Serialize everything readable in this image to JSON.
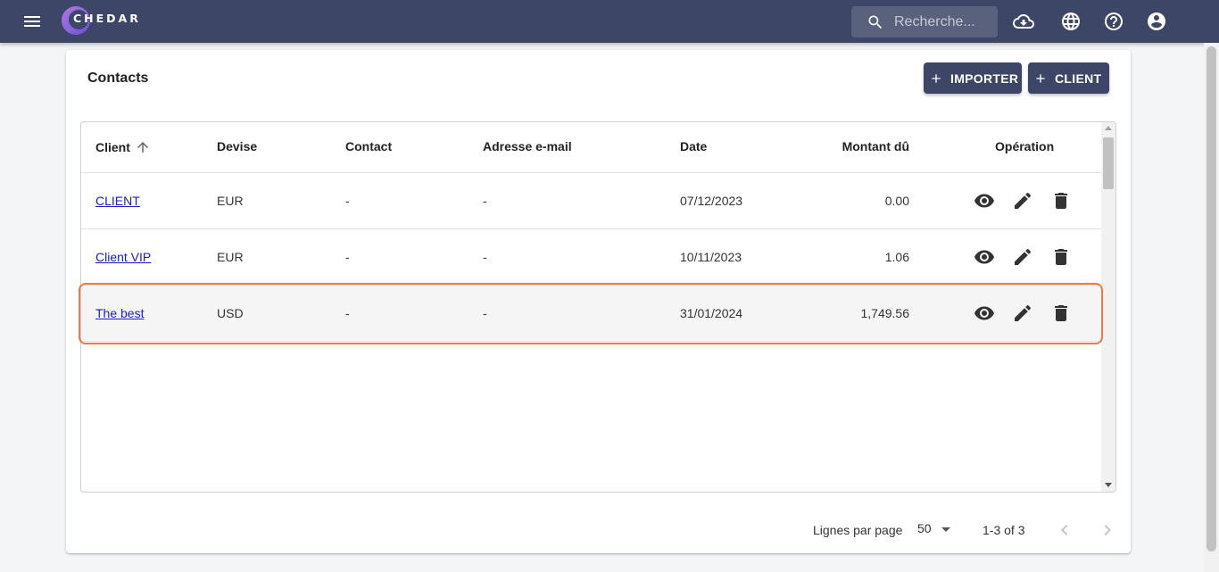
{
  "app": {
    "logo_text": "CHEDAR",
    "search_placeholder": "Recherche..."
  },
  "header_icons": [
    "menu-icon",
    "cloud-download-icon",
    "globe-icon",
    "help-icon",
    "account-circle-icon"
  ],
  "card": {
    "title": "Contacts",
    "import_label": "IMPORTER",
    "client_label": "CLIENT"
  },
  "table": {
    "columns": {
      "client": "Client",
      "devise": "Devise",
      "contact": "Contact",
      "email": "Adresse e-mail",
      "date": "Date",
      "montant": "Montant dû",
      "operation": "Opération"
    },
    "sort": {
      "column": "client",
      "direction": "ascending"
    },
    "rows": [
      {
        "client": "CLIENT",
        "devise": "EUR",
        "contact": "-",
        "email": "-",
        "date": "07/12/2023",
        "montant": "0.00"
      },
      {
        "client": "Client VIP",
        "devise": "EUR",
        "contact": "-",
        "email": "-",
        "date": "10/11/2023",
        "montant": "1.06"
      },
      {
        "client": "The best",
        "devise": "USD",
        "contact": "-",
        "email": "-",
        "date": "31/01/2024",
        "montant": "1,749.56"
      }
    ],
    "highlighted_row": 2,
    "highlight_color": "#ee7a4a"
  },
  "pagination": {
    "rows_per_page_label": "Lignes par page",
    "rows_per_page_value": "50",
    "range_label": "1-3 of 3"
  },
  "colors": {
    "topbar": "#3d4666",
    "button": "#3d4666",
    "link": "#1a1ad4"
  }
}
